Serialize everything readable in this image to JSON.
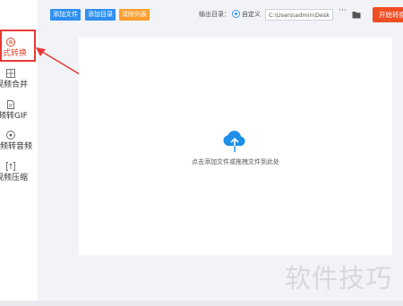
{
  "toolbar": {
    "add_file": "添加文件",
    "add_dir": "添加目录",
    "clear_list": "清除列表",
    "output_label": "输出目录：",
    "radio_label": "自定义",
    "output_path": "C:\\Users\\admin\\Deskto",
    "more": "···",
    "start": "开始转换"
  },
  "sidebar": {
    "items": [
      {
        "label": "格式转换",
        "icon": "format-convert-icon",
        "active": true
      },
      {
        "label": "视频合并",
        "icon": "video-merge-icon"
      },
      {
        "label": "视频转GIF",
        "icon": "video-to-gif-icon"
      },
      {
        "label": "视频转音频",
        "icon": "video-to-audio-icon"
      },
      {
        "label": "视频压缩",
        "icon": "video-compress-icon"
      }
    ]
  },
  "main": {
    "drop_hint": "点击添加文件或拖拽文件到此处"
  },
  "watermark": "软件技巧",
  "colors": {
    "accent_blue": "#2e8ff0",
    "clear_orange": "#ff9d2c",
    "start_red": "#f04e23",
    "annotation_red": "#e53935",
    "upload_icon_blue": "#1e8fe8"
  }
}
